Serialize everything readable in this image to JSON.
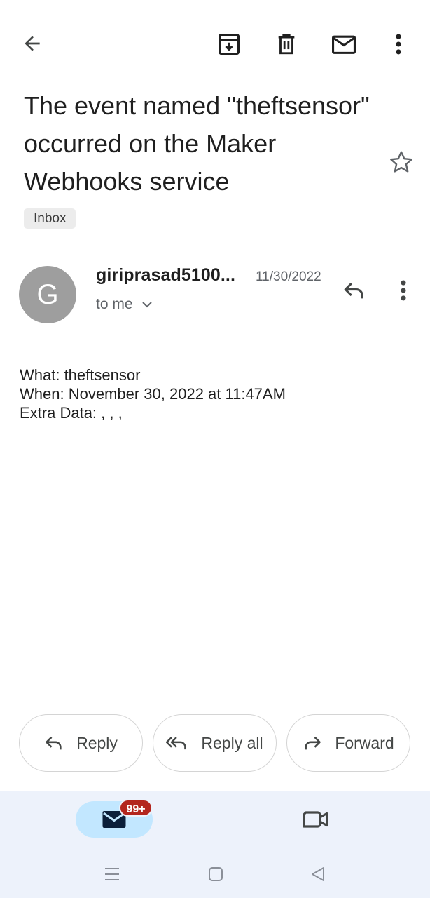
{
  "toolbar": {
    "back_icon": "arrow-back-icon",
    "archive_icon": "archive-icon",
    "delete_icon": "trash-icon",
    "mark_unread_icon": "mail-icon",
    "more_icon": "more-vert-icon"
  },
  "message": {
    "subject": "The event named \"theftsensor\" occurred on the Maker Webhooks service",
    "label": "Inbox",
    "starred": false,
    "sender_initial": "G",
    "sender": "giriprasad5100...",
    "date": "11/30/2022",
    "recipients": "to me",
    "body_lines": [
      "What: theftsensor",
      "When: November 30, 2022 at 11:47AM",
      "Extra Data: , , ,"
    ]
  },
  "actions": {
    "reply_label": "Reply",
    "reply_all_label": "Reply all",
    "forward_label": "Forward"
  },
  "bottom_nav": {
    "mail_badge": "99+",
    "mail_icon": "mail-icon",
    "meet_icon": "video-camera-icon"
  },
  "colors": {
    "accent_tab": "#c2e7ff",
    "badge": "#b3261e",
    "nav_background": "#edf2fb",
    "avatar": "#9e9e9e"
  }
}
